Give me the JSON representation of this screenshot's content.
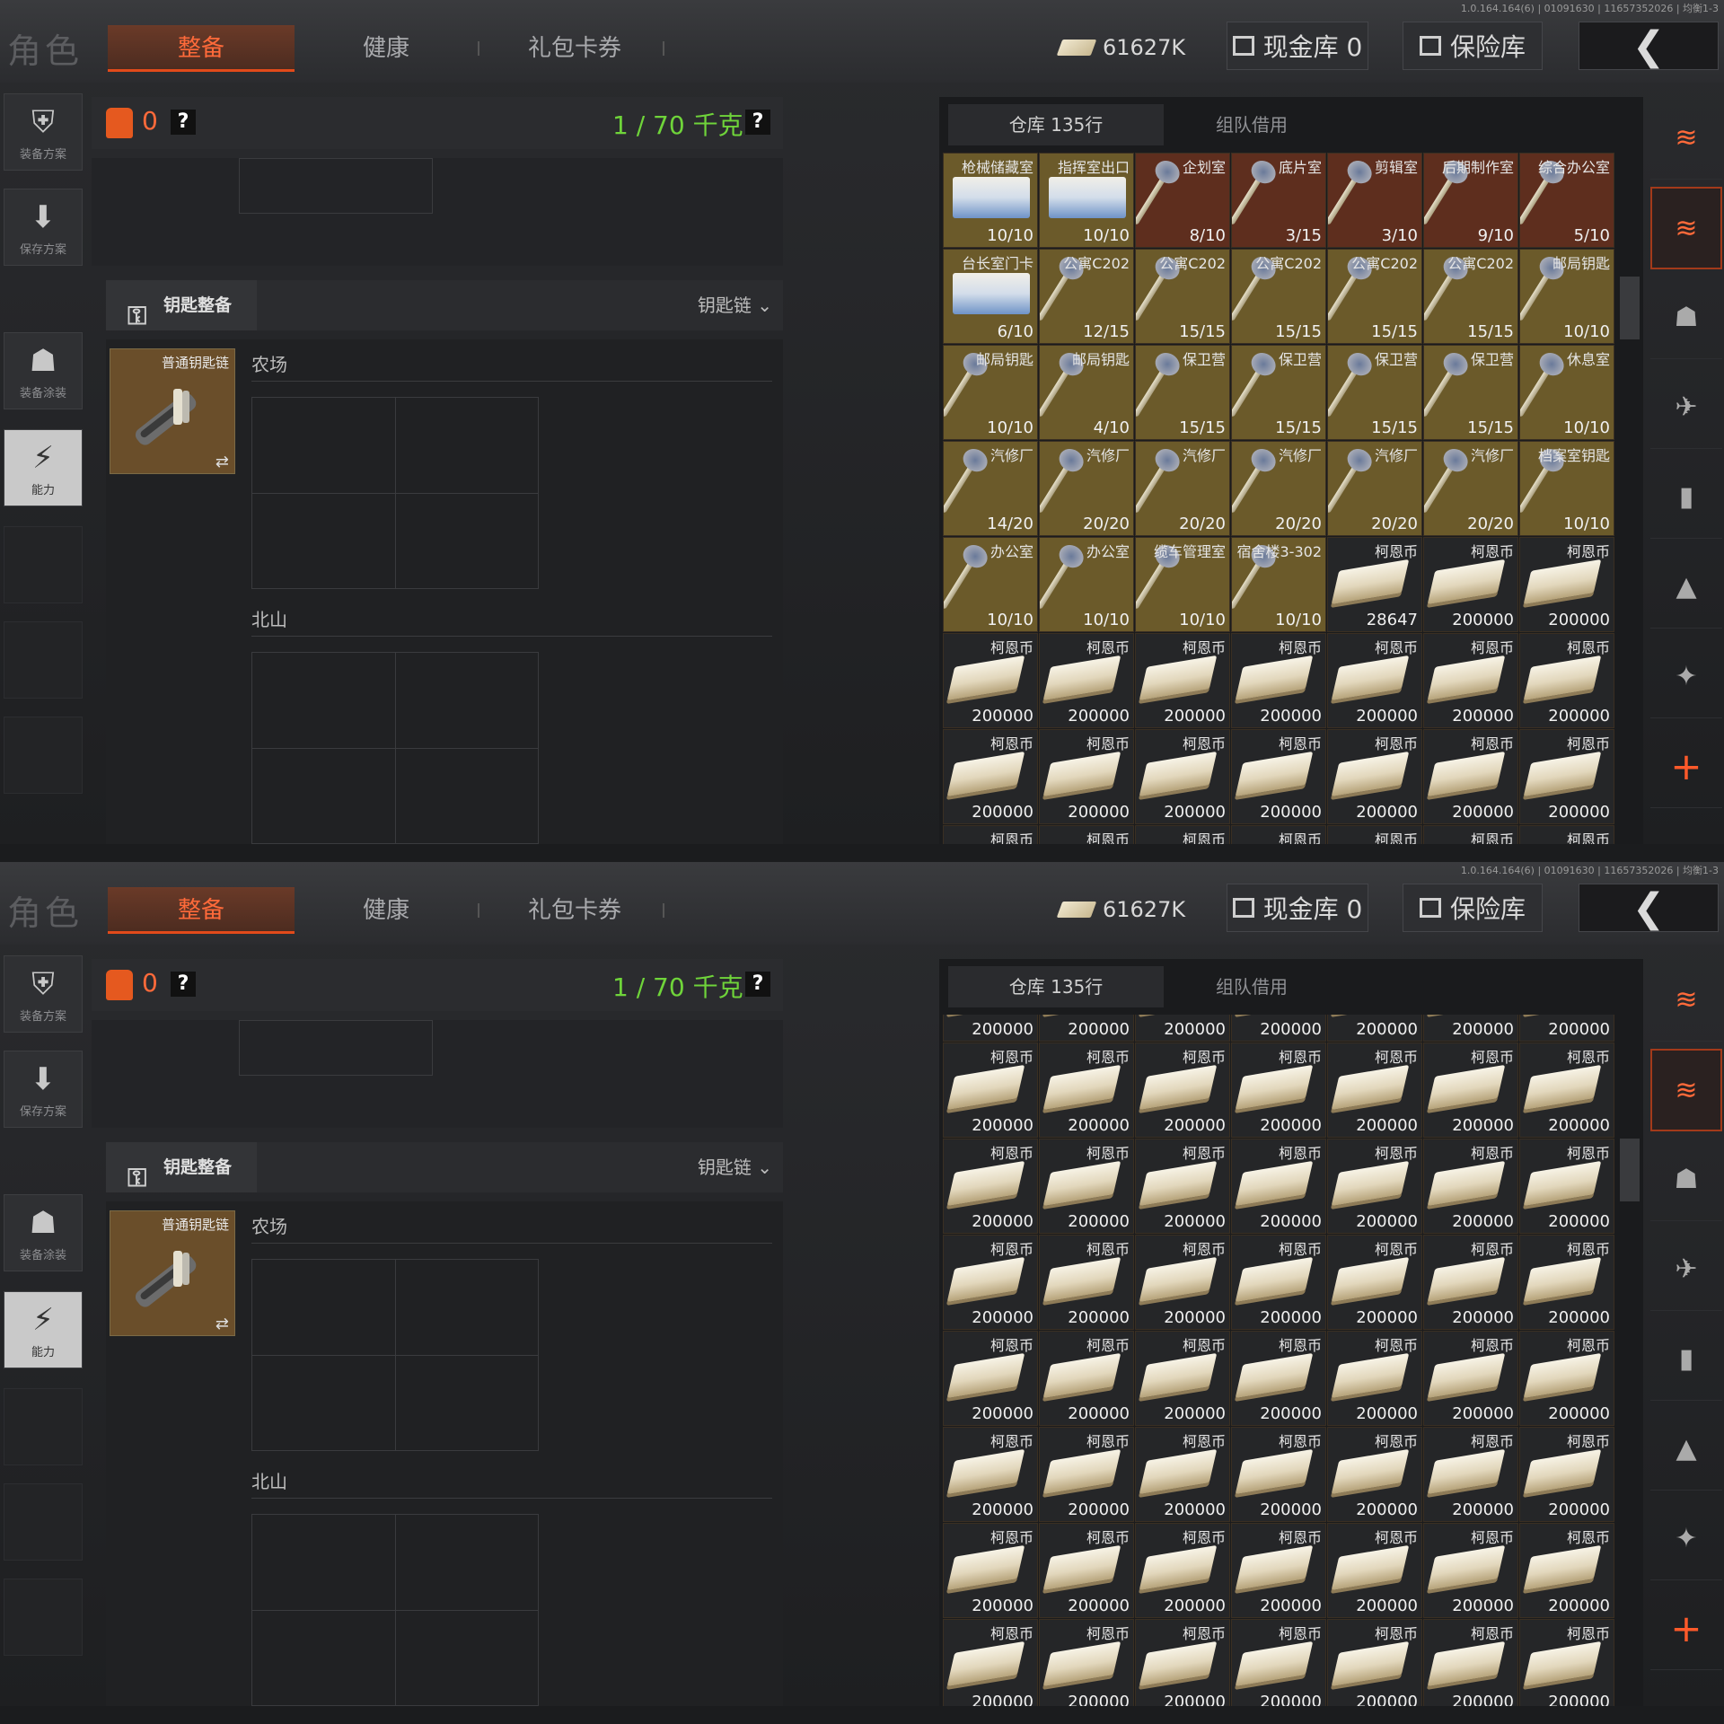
{
  "version": "1.0.164.164(6) | 01091630 | 11657352026 | 均衡1-3",
  "header": {
    "title": "角色",
    "tabs": [
      "整备",
      "健康",
      "礼包卡券"
    ],
    "currency": "61627K",
    "cash_vault_label": "现金库 0",
    "safe_label": "保险库",
    "back_glyph": "❮"
  },
  "leftnav": {
    "items": [
      {
        "label": "装备方案",
        "icon": "vest-icon"
      },
      {
        "label": "保存方案",
        "icon": "download-icon"
      },
      {
        "label": "装备涂装",
        "icon": "helmet-icon"
      },
      {
        "label": "能力",
        "icon": "ability-icon"
      }
    ]
  },
  "equipment": {
    "capacity_zero": "0",
    "weight": "1 / 70 千克",
    "help": "?",
    "key_tab": "钥匙整备",
    "key_dropdown": "钥匙链",
    "keychain_label": "普通钥匙链",
    "zones": [
      "农场",
      "北山"
    ]
  },
  "stash": {
    "tab_warehouse": "仓库 135行",
    "tab_team": "组队借用",
    "screen1_rows": [
      [
        {
          "name": "枪械储藏室",
          "count": "10/10",
          "type": "card"
        },
        {
          "name": "指挥室出口",
          "count": "10/10",
          "type": "card"
        },
        {
          "name": "企划室",
          "count": "8/10",
          "type": "red"
        },
        {
          "name": "底片室",
          "count": "3/15",
          "type": "red"
        },
        {
          "name": "剪辑室",
          "count": "3/10",
          "type": "red"
        },
        {
          "name": "后期制作室",
          "count": "9/10",
          "type": "red"
        },
        {
          "name": "综合办公室",
          "count": "5/10",
          "type": "red"
        }
      ],
      [
        {
          "name": "台长室门卡",
          "count": "6/10",
          "type": "card"
        },
        {
          "name": "公寓C202",
          "count": "12/15",
          "type": "key"
        },
        {
          "name": "公寓C202",
          "count": "15/15",
          "type": "key"
        },
        {
          "name": "公寓C202",
          "count": "15/15",
          "type": "key"
        },
        {
          "name": "公寓C202",
          "count": "15/15",
          "type": "key"
        },
        {
          "name": "公寓C202",
          "count": "15/15",
          "type": "key"
        },
        {
          "name": "邮局钥匙",
          "count": "10/10",
          "type": "key"
        }
      ],
      [
        {
          "name": "邮局钥匙",
          "count": "10/10",
          "type": "key"
        },
        {
          "name": "邮局钥匙",
          "count": "4/10",
          "type": "key"
        },
        {
          "name": "保卫营",
          "count": "15/15",
          "type": "key"
        },
        {
          "name": "保卫营",
          "count": "15/15",
          "type": "key"
        },
        {
          "name": "保卫营",
          "count": "15/15",
          "type": "key"
        },
        {
          "name": "保卫营",
          "count": "15/15",
          "type": "key"
        },
        {
          "name": "休息室",
          "count": "10/10",
          "type": "key"
        }
      ],
      [
        {
          "name": "汽修厂",
          "count": "14/20",
          "type": "key"
        },
        {
          "name": "汽修厂",
          "count": "20/20",
          "type": "key"
        },
        {
          "name": "汽修厂",
          "count": "20/20",
          "type": "key"
        },
        {
          "name": "汽修厂",
          "count": "20/20",
          "type": "key"
        },
        {
          "name": "汽修厂",
          "count": "20/20",
          "type": "key"
        },
        {
          "name": "汽修厂",
          "count": "20/20",
          "type": "key"
        },
        {
          "name": "档案室钥匙",
          "count": "10/10",
          "type": "key"
        }
      ],
      [
        {
          "name": "办公室",
          "count": "10/10",
          "type": "key"
        },
        {
          "name": "办公室",
          "count": "10/10",
          "type": "key"
        },
        {
          "name": "缆车管理室",
          "count": "10/10",
          "type": "key"
        },
        {
          "name": "宿舍楼3-302",
          "count": "10/10",
          "type": "key"
        },
        {
          "name": "柯恩币",
          "count": "28647",
          "type": "cash"
        },
        {
          "name": "柯恩币",
          "count": "200000",
          "type": "cash"
        },
        {
          "name": "柯恩币",
          "count": "200000",
          "type": "cash"
        }
      ]
    ],
    "cash_name": "柯恩币",
    "cash_count": "200000"
  }
}
